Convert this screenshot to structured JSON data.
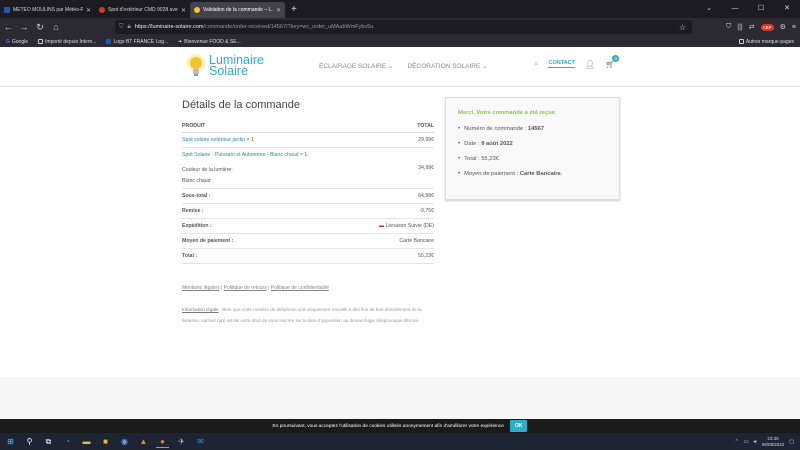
{
  "browser": {
    "tabs": [
      {
        "title": "METEO MOULINS par Météo-F...",
        "color": "#1e5bb0",
        "active": false
      },
      {
        "title": "Spot d'extérieur CMD 9028 ave...",
        "color": "#d23b2a",
        "active": false
      },
      {
        "title": "Validation de la commande – L...",
        "color": "#f4c430",
        "active": true
      }
    ],
    "url_host": "https://luminaire-solaire.com",
    "url_path": "/commande/order-received/14567/?key=wc_order_uMAabWmFybv5u",
    "bookmarks": [
      "Google",
      "Importé depuis Intern...",
      "Logo BT FRANCE Log...",
      "Bienvenue FOOD & SE..."
    ],
    "other_bookmarks": "Autres marque-pages"
  },
  "site": {
    "logo_line1": "Luminaire",
    "logo_line2": "Solaire",
    "menu": [
      "ÉCLAIRAGE SOLAIRE",
      "DÉCORATION SOLAIRE"
    ],
    "contact": "CONTACT",
    "cart_count": "0"
  },
  "order": {
    "title": "Détails de la commande",
    "col_product": "PRODUIT",
    "col_total": "TOTAL",
    "item1_name": "Spot solaire extérieur jardin",
    "item1_qty": " × 1",
    "item1_price": "29,99€",
    "item2_name": "Spot Solaire - Puissant et Autonome - Blanc chaud",
    "item2_qty": " × 1",
    "item2_attr_label": "Couleur de la lumière:",
    "item2_attr_value": "Blanc chaud",
    "item2_price": "34,99€",
    "subtotal_label": "Sous-total :",
    "subtotal": "64,98€",
    "discount_label": "Remise :",
    "discount": "-9,75€",
    "shipping_label": "Expédition :",
    "shipping": "Livraison Suivie (DE)",
    "payment_label": "Moyen de paiement :",
    "payment": "Carte Bancaire",
    "total_label": "Total :",
    "total": "55,23€"
  },
  "legal": {
    "links": [
      "Mentions légales",
      "Politique de retours",
      "Politique de confidentialité"
    ],
    "sep": " | ",
    "info_label": "Information légale",
    "info_text": " : Bien que votre numéro de téléphone soit uniquement recueilli à des fins de bon déroulement de la livraison, sachez qu'il est de votre droit de vous inscrire sur la liste d'opposition au démarchage téléphonique Bloctel."
  },
  "summary": {
    "thanks": "Merci. Votre commande a été reçue.",
    "order_number_label": "Numéro de commande : ",
    "order_number": "14567",
    "date_label": "Date : ",
    "date": "9 août 2022",
    "total_label": "Total : ",
    "total": "55,23€",
    "payment_label": "Moyen de paiement : ",
    "payment": "Carte Bancaire",
    "payment_end": "."
  },
  "cookie": {
    "text": "En poursuivant, vous acceptez l'utilisation de cookies utilisés anonymement afin d'améliorer votre expérience",
    "ok": "OK"
  },
  "taskbar": {
    "time": "23:35",
    "date": "09/08/2022"
  }
}
